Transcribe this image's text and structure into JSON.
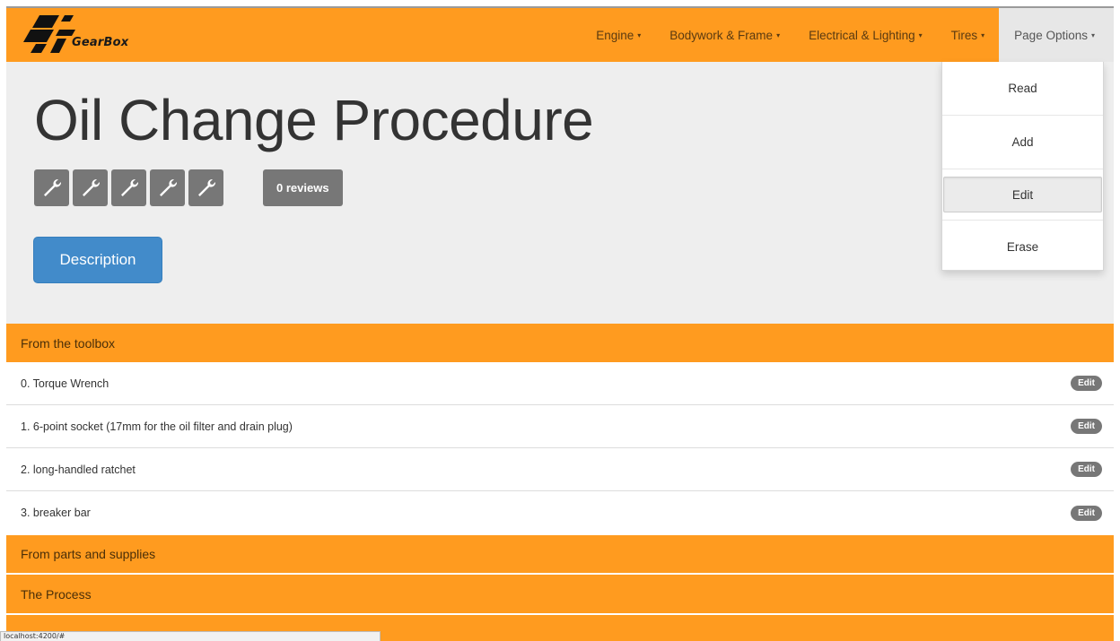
{
  "brand": {
    "logo_text": "GearBox"
  },
  "nav": {
    "items": [
      {
        "label": "Engine",
        "caret": "▾"
      },
      {
        "label": "Bodywork & Frame",
        "caret": "▾"
      },
      {
        "label": "Electrical & Lighting",
        "caret": "▾"
      },
      {
        "label": "Tires",
        "caret": "▾"
      },
      {
        "label": "Page Options",
        "caret": "▾",
        "active": true
      }
    ]
  },
  "page_options_menu": {
    "items": [
      "Read",
      "Add",
      "Edit",
      "Erase"
    ],
    "selected": "Edit"
  },
  "jumbotron": {
    "title": "Oil Change Procedure",
    "rating": {
      "icon": "wrench-icon",
      "max": 5,
      "filled": 0
    },
    "reviews_label": "0 reviews",
    "description_button": "Description"
  },
  "sections": {
    "toolbox": {
      "heading": "From the toolbox",
      "items": [
        {
          "text": "0. Torque Wrench",
          "action": "Edit"
        },
        {
          "text": "1. 6-point socket (17mm for the oil filter and drain plug)",
          "action": "Edit"
        },
        {
          "text": "2. long-handled ratchet",
          "action": "Edit"
        },
        {
          "text": "3. breaker bar",
          "action": "Edit"
        }
      ]
    },
    "parts": {
      "heading": "From parts and supplies"
    },
    "process": {
      "heading": "The Process"
    }
  },
  "status_bar": {
    "text": "localhost:4200/#"
  },
  "colors": {
    "navbar": "#ff9b1f",
    "jumbotron": "#eeeeee",
    "primary_button": "#428bca",
    "badge": "#777777"
  }
}
